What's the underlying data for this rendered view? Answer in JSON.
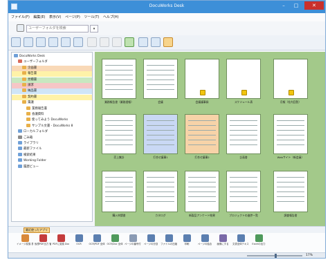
{
  "window": {
    "title": "DocuWorks Desk"
  },
  "menu": [
    "ファイル(F)",
    "編集(E)",
    "表示(V)",
    "ページ(P)",
    "ツール(T)",
    "ヘルプ(H)"
  ],
  "search": {
    "placeholder": "ユーザーフォルダを検索"
  },
  "tree": [
    {
      "label": "DocuWorks Desk",
      "indent": 0,
      "color": "#6fa0d8"
    },
    {
      "label": "ユーザーフォルダ",
      "indent": 1,
      "color": "#d96b5b"
    },
    {
      "label": "企画書",
      "indent": 2,
      "color": "#e8b04a"
    },
    {
      "label": "報告書",
      "indent": 2,
      "color": "#e8b04a"
    },
    {
      "label": "見積書",
      "indent": 2,
      "color": "#e8b04a"
    },
    {
      "label": "請求",
      "indent": 2,
      "color": "#e8b04a"
    },
    {
      "label": "納品書",
      "indent": 2,
      "color": "#e8b04a"
    },
    {
      "label": "契約書",
      "indent": 2,
      "color": "#e8b04a"
    },
    {
      "label": "稟議",
      "indent": 2,
      "color": "#e8b04a"
    },
    {
      "label": "業務報告書",
      "indent": 3,
      "color": "#e8b04a"
    },
    {
      "label": "会議資料",
      "indent": 3,
      "color": "#e8b04a"
    },
    {
      "label": "使ってみよう DocuWorks",
      "indent": 3,
      "color": "#e8b04a"
    },
    {
      "label": "サンプル文書 - DocuWorks 8",
      "indent": 3,
      "color": "#e8b04a"
    },
    {
      "label": "ローカルフォルダ",
      "indent": 1,
      "color": "#6fa0d8"
    },
    {
      "label": "ごみ箱",
      "indent": 1,
      "color": "#8a8a8a"
    },
    {
      "label": "ライブラリ",
      "indent": 1,
      "color": "#6fa0d8"
    },
    {
      "label": "最新ファイル",
      "indent": 1,
      "color": "#6fa0d8"
    },
    {
      "label": "検索結果",
      "indent": 1,
      "color": "#6fa0d8"
    },
    {
      "label": "Working Folder",
      "indent": 1,
      "color": "#6fa0d8"
    },
    {
      "label": "履歴ビュー",
      "indent": 1,
      "color": "#6fa0d8"
    }
  ],
  "thumbnails": [
    {
      "label": "業務報告書（業務週報）",
      "locked": false
    },
    {
      "label": "会議",
      "locked": false
    },
    {
      "label": "会議議事録",
      "locked": true
    },
    {
      "label": "スケジュール表",
      "locked": true
    },
    {
      "label": "月報（社内回覧）",
      "locked": true
    },
    {
      "label": "売上集計",
      "locked": false
    },
    {
      "label": "打合せ議事1",
      "locked": false
    },
    {
      "label": "打合せ議事2",
      "locked": false
    },
    {
      "label": "企画書",
      "locked": false
    },
    {
      "label": "Webサイト（新会員）",
      "locked": false
    },
    {
      "label": "購入申請書",
      "locked": false
    },
    {
      "label": "カタログ",
      "locked": false
    },
    {
      "label": "新製品アンケート結果",
      "locked": false
    },
    {
      "label": "プロジェクトの進捗一覧",
      "locked": false
    },
    {
      "label": "調査報告書",
      "locked": false
    }
  ],
  "bottom_tab": "最近使ったアプリ",
  "launcher": [
    {
      "label": "イメージ変換 表示",
      "color": "#d9893a"
    },
    {
      "label": "仮想PDF出力 管理・変換",
      "color": "#c43c3c"
    },
    {
      "label": "PDFに変換 DocuWorks",
      "color": "#c43c3c"
    },
    {
      "label": "OCR",
      "color": "#5b7fb0"
    },
    {
      "label": "OCR/PDF 全体",
      "color": "#5b7fb0"
    },
    {
      "label": "OCR/Doc 全体",
      "color": "#4f9a5c"
    },
    {
      "label": "ページの番号付け",
      "color": "#8a9bb4"
    },
    {
      "label": "ページの分割",
      "color": "#5b7fb0"
    },
    {
      "label": "ファイルの圧縮",
      "color": "#5b7fb0"
    },
    {
      "label": "印刷",
      "color": "#5b7fb0"
    },
    {
      "label": "ページの結合",
      "color": "#5b7fb0"
    },
    {
      "label": "画像にする",
      "color": "#7a6aa8"
    },
    {
      "label": "文書全体テキスト",
      "color": "#5b7fb0"
    },
    {
      "label": "Excelの出力",
      "color": "#4f9a5c"
    }
  ],
  "status": {
    "zoom": "17%"
  }
}
